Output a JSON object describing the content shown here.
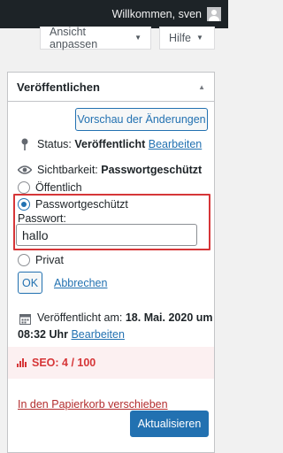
{
  "admin_bar": {
    "greeting": "Willkommen, sven"
  },
  "screen_options": {
    "customize_label": "Ansicht anpassen",
    "help_label": "Hilfe"
  },
  "publish_box": {
    "title": "Veröffentlichen",
    "preview_label": "Vorschau der Änderungen",
    "status": {
      "label": "Status:",
      "value": "Veröffentlicht",
      "edit": "Bearbeiten"
    },
    "visibility": {
      "label": "Sichtbarkeit:",
      "value": "Passwortgeschützt"
    },
    "visibility_options": [
      "Öffentlich",
      "Passwortgeschützt",
      "Privat"
    ],
    "selected_option": "Passwortgeschützt",
    "password": {
      "label": "Passwort:",
      "value": "hallo"
    },
    "ok_label": "OK",
    "cancel_label": "Abbrechen",
    "published": {
      "label": "Veröffentlicht am:",
      "date": "18. Mai. 2020 um",
      "time": "08:32 Uhr",
      "edit": "Bearbeiten"
    },
    "seo": {
      "label": "SEO: 4 / 100"
    },
    "trash_label": "In den Papierkorb verschieben",
    "update_label": "Aktualisieren"
  },
  "colors": {
    "accent": "#2271b1",
    "error": "#d63638",
    "admin_bar": "#1d2327"
  }
}
